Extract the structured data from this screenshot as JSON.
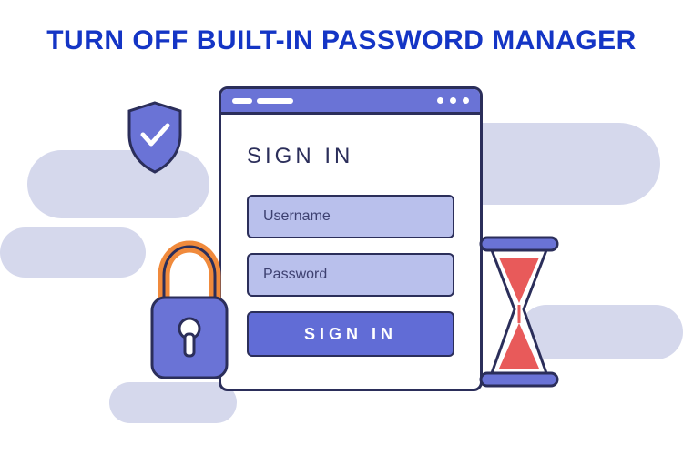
{
  "title": "TURN OFF BUILT-IN PASSWORD MANAGER",
  "signin": {
    "heading": "SIGN IN",
    "username_placeholder": "Username",
    "password_placeholder": "Password",
    "button_label": "SIGN IN"
  },
  "colors": {
    "title": "#1435c5",
    "outline": "#2b2e5a",
    "primary": "#616cd6",
    "field": "#b9c0ec",
    "blob": "#d5d8ec",
    "accent_orange": "#f08a3c",
    "accent_red": "#e85a5a"
  }
}
